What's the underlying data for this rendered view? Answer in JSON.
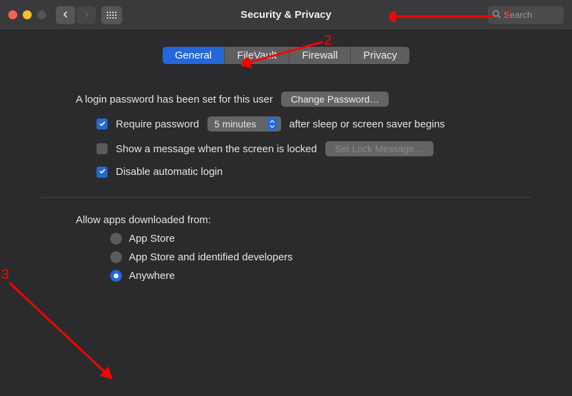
{
  "titlebar": {
    "title": "Security & Privacy",
    "search_placeholder": "Search"
  },
  "tabs": [
    {
      "label": "General",
      "active": true
    },
    {
      "label": "FileVault",
      "active": false
    },
    {
      "label": "Firewall",
      "active": false
    },
    {
      "label": "Privacy",
      "active": false
    }
  ],
  "general": {
    "login_password_text": "A login password has been set for this user",
    "change_password_label": "Change Password…",
    "require_password_label": "Require password",
    "require_password_delay": "5 minutes",
    "require_password_suffix": "after sleep or screen saver begins",
    "show_message_label": "Show a message when the screen is locked",
    "set_lock_message_label": "Set Lock Message…",
    "disable_auto_login_label": "Disable automatic login",
    "allow_apps_label": "Allow apps downloaded from:",
    "radio_options": [
      {
        "label": "App Store",
        "selected": false
      },
      {
        "label": "App Store and identified developers",
        "selected": false
      },
      {
        "label": "Anywhere",
        "selected": true
      }
    ]
  },
  "annotations": {
    "n1": "1",
    "n2": "2",
    "n3": "3"
  }
}
